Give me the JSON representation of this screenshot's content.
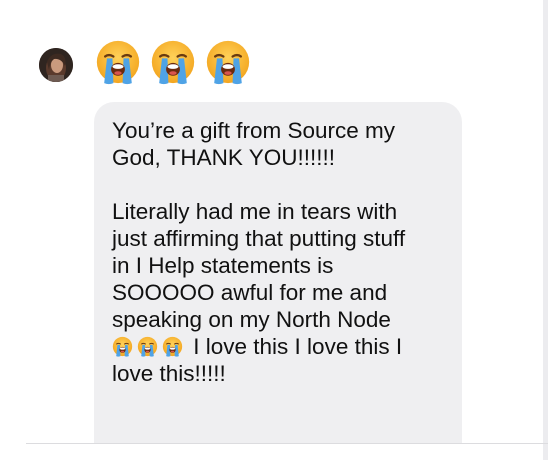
{
  "reaction": {
    "icons": [
      "loudly-crying-face",
      "loudly-crying-face",
      "loudly-crying-face"
    ]
  },
  "message": {
    "line_1": "You’re a gift from Source my",
    "line_2": "God, THANK YOU!!!!!!",
    "line_3": "Literally had me in tears with",
    "line_4": "just affirming that putting stuff",
    "line_5": "in I Help statements is",
    "line_6": "SOOOOO awful for me and",
    "line_7": "speaking on my North Node",
    "line_8": "I love this I love this I",
    "line_9": "love this!!!!!",
    "inline_icons": [
      "loudly-crying-face",
      "loudly-crying-face",
      "loudly-crying-face"
    ]
  },
  "colors": {
    "bubble": "#efeff1",
    "text": "#111111",
    "emoji_face": "#f7b733",
    "emoji_tears": "#4fa3e6"
  }
}
